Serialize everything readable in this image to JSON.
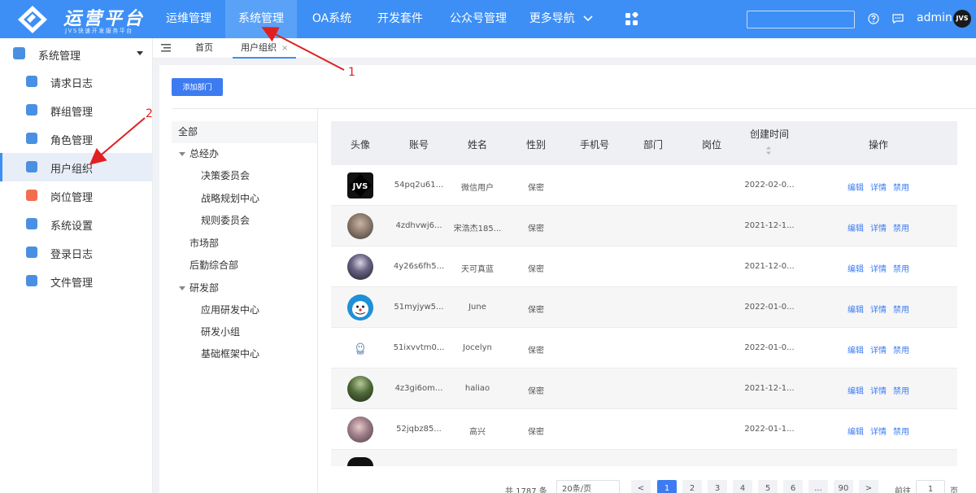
{
  "header": {
    "logo_title": "运营平台",
    "logo_subtitle": "JVS快速开发服务平台",
    "nav": [
      {
        "label": "运维管理"
      },
      {
        "label": "系统管理",
        "active": true
      },
      {
        "label": "OA系统"
      },
      {
        "label": "开发套件"
      },
      {
        "label": "公众号管理"
      },
      {
        "label": "更多导航"
      }
    ],
    "search_placeholder": "",
    "user_name": "admin",
    "user_avatar_text": "JVS"
  },
  "sidebar": {
    "group_label": "系统管理",
    "items": [
      {
        "label": "请求日志",
        "icon": "request-log-icon",
        "color": "#4a90e2"
      },
      {
        "label": "群组管理",
        "icon": "group-icon",
        "color": "#4a90e2"
      },
      {
        "label": "角色管理",
        "icon": "role-icon",
        "color": "#4a90e2"
      },
      {
        "label": "用户组织",
        "icon": "org-icon",
        "color": "#4a90e2",
        "active": true
      },
      {
        "label": "岗位管理",
        "icon": "post-icon",
        "color": "#f26d4f"
      },
      {
        "label": "系统设置",
        "icon": "settings-icon",
        "color": "#4a90e2"
      },
      {
        "label": "登录日志",
        "icon": "login-log-icon",
        "color": "#4a90e2"
      },
      {
        "label": "文件管理",
        "icon": "file-icon",
        "color": "#4a90e2"
      }
    ]
  },
  "tabs": [
    {
      "label": "首页"
    },
    {
      "label": "用户组织",
      "active": true,
      "close": "×"
    }
  ],
  "toolbar": {
    "add_dept_label": "添加部门"
  },
  "tree": {
    "root": "全部",
    "nodes": [
      {
        "label": "总经办",
        "level": 1,
        "expanded": true
      },
      {
        "label": "决策委员会",
        "level": 2
      },
      {
        "label": "战略规划中心",
        "level": 2
      },
      {
        "label": "规则委员会",
        "level": 2
      },
      {
        "label": "市场部",
        "level": 1
      },
      {
        "label": "后勤综合部",
        "level": 1
      },
      {
        "label": "研发部",
        "level": 1,
        "expanded": true
      },
      {
        "label": "应用研发中心",
        "level": 2
      },
      {
        "label": "研发小组",
        "level": 2
      },
      {
        "label": "基础框架中心",
        "level": 2
      }
    ]
  },
  "table": {
    "columns": [
      "头像",
      "账号",
      "姓名",
      "性别",
      "手机号",
      "部门",
      "岗位",
      "创建时间",
      "操作"
    ],
    "rows": [
      {
        "account": "54pq2u61...",
        "name": "微信用户",
        "gender": "保密",
        "phone": "",
        "dept": "",
        "post": "",
        "created": "2022-02-0...",
        "avatar": "jvs-logo"
      },
      {
        "account": "4zdhvwj6...",
        "name": "宋浩杰185...",
        "gender": "保密",
        "phone": "",
        "dept": "",
        "post": "",
        "created": "2021-12-1...",
        "avatar": "photo-face"
      },
      {
        "account": "4y26s6fh5...",
        "name": "天可真蓝",
        "gender": "保密",
        "phone": "",
        "dept": "",
        "post": "",
        "created": "2021-12-0...",
        "avatar": "photo-night"
      },
      {
        "account": "51myjyw5...",
        "name": "June",
        "gender": "保密",
        "phone": "",
        "dept": "",
        "post": "",
        "created": "2022-01-0...",
        "avatar": "cartoon-blue"
      },
      {
        "account": "51ixvvtm0...",
        "name": "Jocelyn",
        "gender": "保密",
        "phone": "",
        "dept": "",
        "post": "",
        "created": "2022-01-0...",
        "avatar": "cartoon-small"
      },
      {
        "account": "4z3gi6om...",
        "name": "haliao",
        "gender": "保密",
        "phone": "",
        "dept": "",
        "post": "",
        "created": "2021-12-1...",
        "avatar": "photo-green"
      },
      {
        "account": "52jqbz85...",
        "name": "高兴",
        "gender": "保密",
        "phone": "",
        "dept": "",
        "post": "",
        "created": "2022-01-1...",
        "avatar": "photo-person"
      }
    ],
    "ops": {
      "edit": "编辑",
      "detail": "详情",
      "disable": "禁用"
    }
  },
  "pagination": {
    "total_text": "共 1787 条",
    "page_size_text": "20条/页",
    "prev": "<",
    "pages": [
      "1",
      "2",
      "3",
      "4",
      "5",
      "6",
      "...",
      "90"
    ],
    "current": "1",
    "next": ">",
    "goto_label": "前往",
    "goto_value": "1",
    "goto_suffix": "页"
  },
  "annotations": [
    {
      "label": "1"
    },
    {
      "label": "2"
    }
  ],
  "colors": {
    "header": "#3d8ff5",
    "primary": "#3d7cf0",
    "annotation": "#e02020"
  }
}
